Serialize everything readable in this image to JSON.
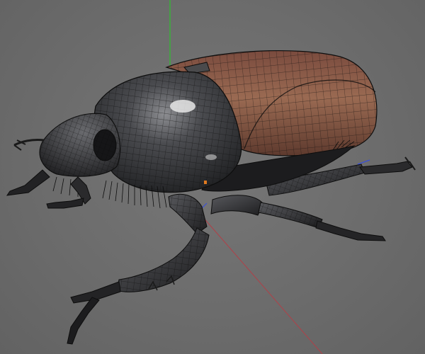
{
  "viewport": {
    "background_color": "#6e6e6e",
    "display_mode": "shaded-wireframe",
    "object": "beetle-model",
    "axes": {
      "x_color": "#c0404a",
      "y_color": "#2fbf2f",
      "z_color": "#3a4fd8"
    },
    "colors": {
      "head_shell": "#2a2a2c",
      "pronotum": "#3c3d40",
      "elytra": "#8a5a45",
      "legs": "#2c2c2e",
      "wire": "#0d0d0d",
      "highlight": "#e8e8e8"
    }
  }
}
